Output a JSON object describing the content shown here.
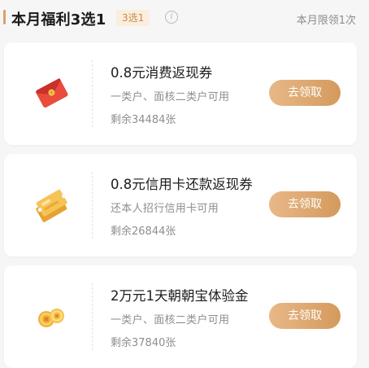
{
  "header": {
    "title": "本月福利3选1",
    "badge": "3选1",
    "info_icon": "info-icon",
    "limit": "本月限领1次"
  },
  "cards": [
    {
      "icon": "red-envelope-icon",
      "title": "0.8元消费返现券",
      "subtitle": "一类户、面核二类户可用",
      "remaining": "剩余34484张",
      "button": "去领取"
    },
    {
      "icon": "gold-coupon-icon",
      "title": "0.8元信用卡还款返现券",
      "subtitle": "还本人招行信用卡可用",
      "remaining": "剩余26844张",
      "button": "去领取"
    },
    {
      "icon": "gold-coins-icon",
      "title": "2万元1天朝朝宝体验金",
      "subtitle": "一类户、面核二类户可用",
      "remaining": "剩余37840张",
      "button": "去领取"
    }
  ],
  "colors": {
    "accent": "#d9a16b",
    "button_start": "#e8b888",
    "button_end": "#d49a5c",
    "badge_bg": "#fbeedd",
    "badge_text": "#c68a4a",
    "envelope_red": "#e94b3c"
  }
}
